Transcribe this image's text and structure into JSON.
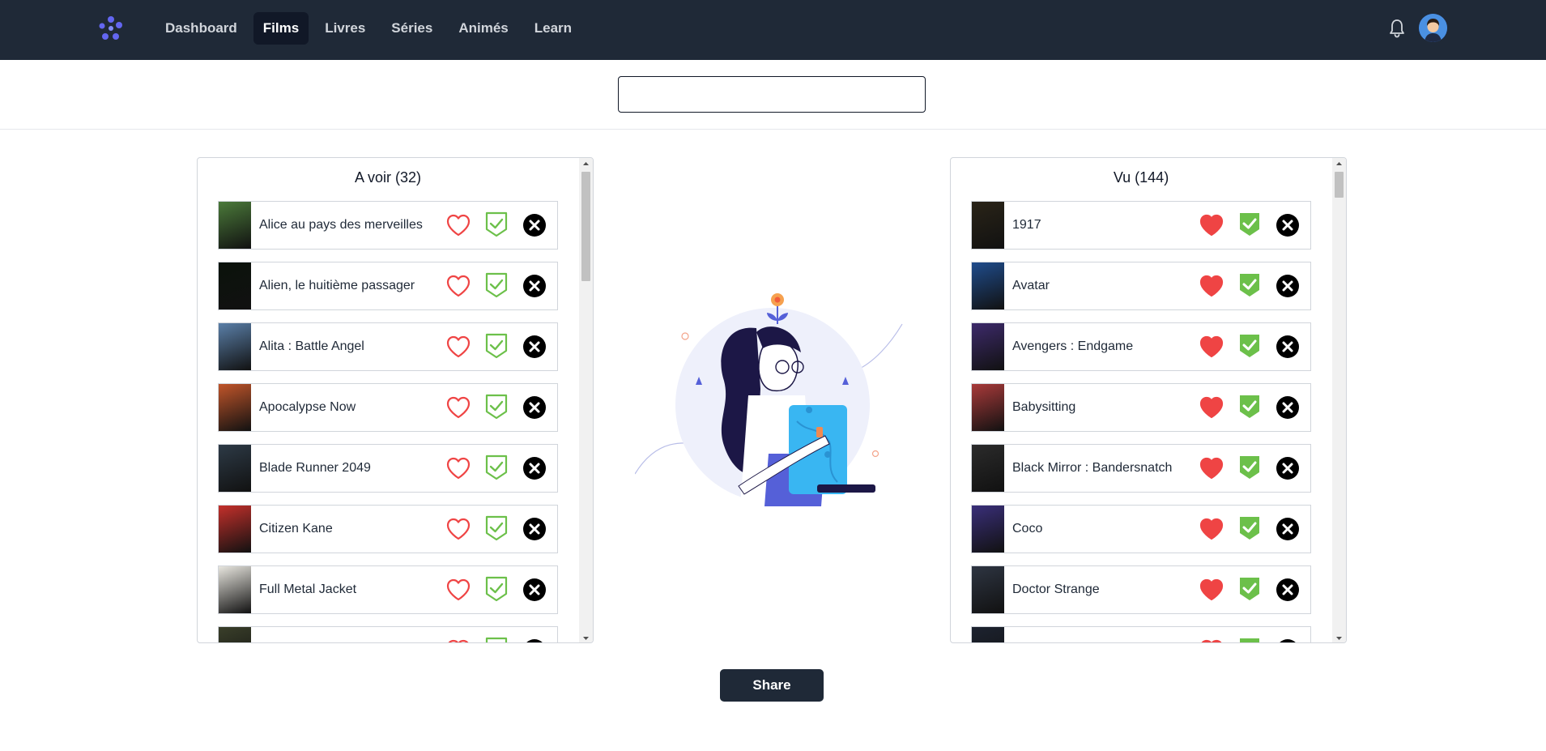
{
  "nav": {
    "items": [
      {
        "label": "Dashboard",
        "active": false
      },
      {
        "label": "Films",
        "active": true
      },
      {
        "label": "Livres",
        "active": false
      },
      {
        "label": "Séries",
        "active": false
      },
      {
        "label": "Animés",
        "active": false
      },
      {
        "label": "Learn",
        "active": false
      }
    ]
  },
  "search": {
    "value": "",
    "placeholder": ""
  },
  "to_watch": {
    "title": "A voir (32)",
    "items": [
      {
        "title": "Alice au pays des merveilles",
        "poster_color": "#4b7a3a"
      },
      {
        "title": "Alien, le huitième passager",
        "poster_color": "#0b120b"
      },
      {
        "title": "Alita : Battle Angel",
        "poster_color": "#5a7fa8"
      },
      {
        "title": "Apocalypse Now",
        "poster_color": "#c1552a"
      },
      {
        "title": "Blade Runner 2049",
        "poster_color": "#2d3a46"
      },
      {
        "title": "Citizen Kane",
        "poster_color": "#c4302b"
      },
      {
        "title": "Full Metal Jacket",
        "poster_color": "#e8e6df"
      },
      {
        "title": "",
        "poster_color": "#3a3f2a"
      }
    ]
  },
  "watched": {
    "title": "Vu (144)",
    "items": [
      {
        "title": "1917",
        "poster_color": "#2a2418"
      },
      {
        "title": "Avatar",
        "poster_color": "#1f4c8c"
      },
      {
        "title": "Avengers : Endgame",
        "poster_color": "#3d2a6b"
      },
      {
        "title": "Babysitting",
        "poster_color": "#a93a3a"
      },
      {
        "title": "Black Mirror : Bandersnatch",
        "poster_color": "#2b2b2b"
      },
      {
        "title": "Coco",
        "poster_color": "#3a2f7a"
      },
      {
        "title": "Doctor Strange",
        "poster_color": "#2e3542"
      },
      {
        "title": "",
        "poster_color": "#1d2330"
      }
    ]
  },
  "share": {
    "label": "Share"
  },
  "colors": {
    "navbar": "#1f2937",
    "heart": "#ef4444",
    "check": "#6cc04a",
    "close": "#000000",
    "logo": "#6366f1"
  },
  "icons": {
    "logo": "logo-icon",
    "bell": "bell-icon",
    "avatar": "avatar",
    "heart_outline": "heart-outline-icon",
    "heart_filled": "heart-filled-icon",
    "check_outline": "check-shield-outline-icon",
    "check_filled": "check-shield-filled-icon",
    "close": "close-icon"
  }
}
